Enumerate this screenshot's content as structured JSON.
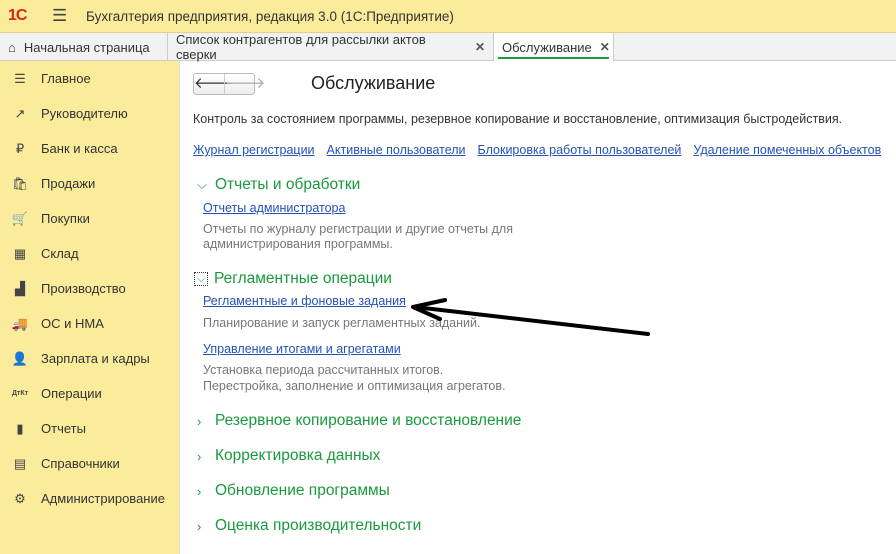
{
  "app": {
    "logo": "1С",
    "title": "Бухгалтерия предприятия, редакция 3.0  (1С:Предприятие)"
  },
  "tabs": [
    {
      "label": "Начальная страница"
    },
    {
      "label": "Список контрагентов для рассылки актов сверки"
    },
    {
      "label": "Обслуживание"
    }
  ],
  "sidebar": {
    "items": [
      {
        "label": "Главное",
        "icon": "☰"
      },
      {
        "label": "Руководителю",
        "icon": "↗"
      },
      {
        "label": "Банк и касса",
        "icon": "₽"
      },
      {
        "label": "Продажи",
        "icon": "🛍"
      },
      {
        "label": "Покупки",
        "icon": "🛒"
      },
      {
        "label": "Склад",
        "icon": "▦"
      },
      {
        "label": "Производство",
        "icon": "▟"
      },
      {
        "label": "ОС и НМА",
        "icon": "🚚"
      },
      {
        "label": "Зарплата и кадры",
        "icon": "👤"
      },
      {
        "label": "Операции",
        "icon": "ДтКт"
      },
      {
        "label": "Отчеты",
        "icon": "▮"
      },
      {
        "label": "Справочники",
        "icon": "▤"
      },
      {
        "label": "Администрирование",
        "icon": "⚙"
      }
    ]
  },
  "main": {
    "title": "Обслуживание",
    "description": "Контроль за состоянием программы, резервное копирование и восстановление, оптимизация быстродействия.",
    "links": [
      "Журнал регистрации",
      "Активные пользователи",
      "Блокировка работы пользователей",
      "Удаление помеченных объектов"
    ],
    "sections": {
      "reports": {
        "title": "Отчеты и обработки",
        "link": "Отчеты администратора",
        "desc1": "Отчеты по журналу регистрации и другие отчеты для",
        "desc2": "администрирования программы."
      },
      "routine": {
        "title": "Регламентные операции",
        "link1": "Регламентные и фоновые задания",
        "desc1": "Планирование и запуск регламентных заданий.",
        "link2": "Управление итогами и агрегатами",
        "desc2a": "Установка периода рассчитанных итогов.",
        "desc2b": "Перестройка, заполнение и оптимизация агрегатов."
      },
      "backup": {
        "title": "Резервное копирование и восстановление"
      },
      "correction": {
        "title": "Корректировка данных"
      },
      "update": {
        "title": "Обновление программы"
      },
      "performance": {
        "title": "Оценка производительности"
      }
    }
  }
}
